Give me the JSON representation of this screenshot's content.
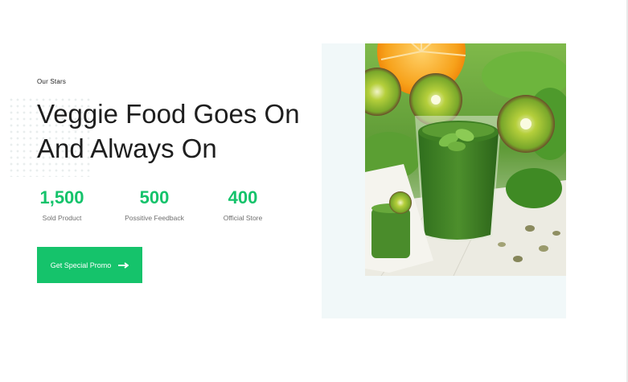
{
  "hero": {
    "eyebrow": "Our Stars",
    "headline": "Veggie Food Goes On And Always On"
  },
  "stats": [
    {
      "value": "1,500",
      "label": "Sold Product"
    },
    {
      "value": "500",
      "label": "Possitive Feedback"
    },
    {
      "value": "400",
      "label": "Official Store"
    }
  ],
  "cta": {
    "label": "Get Special Promo",
    "icon": "arrow-right-icon"
  },
  "colors": {
    "accent": "#15c36b",
    "backdrop": "#f1f8f9",
    "text": "#1e1e1e"
  },
  "image": {
    "icon": "green-smoothie-photo"
  }
}
